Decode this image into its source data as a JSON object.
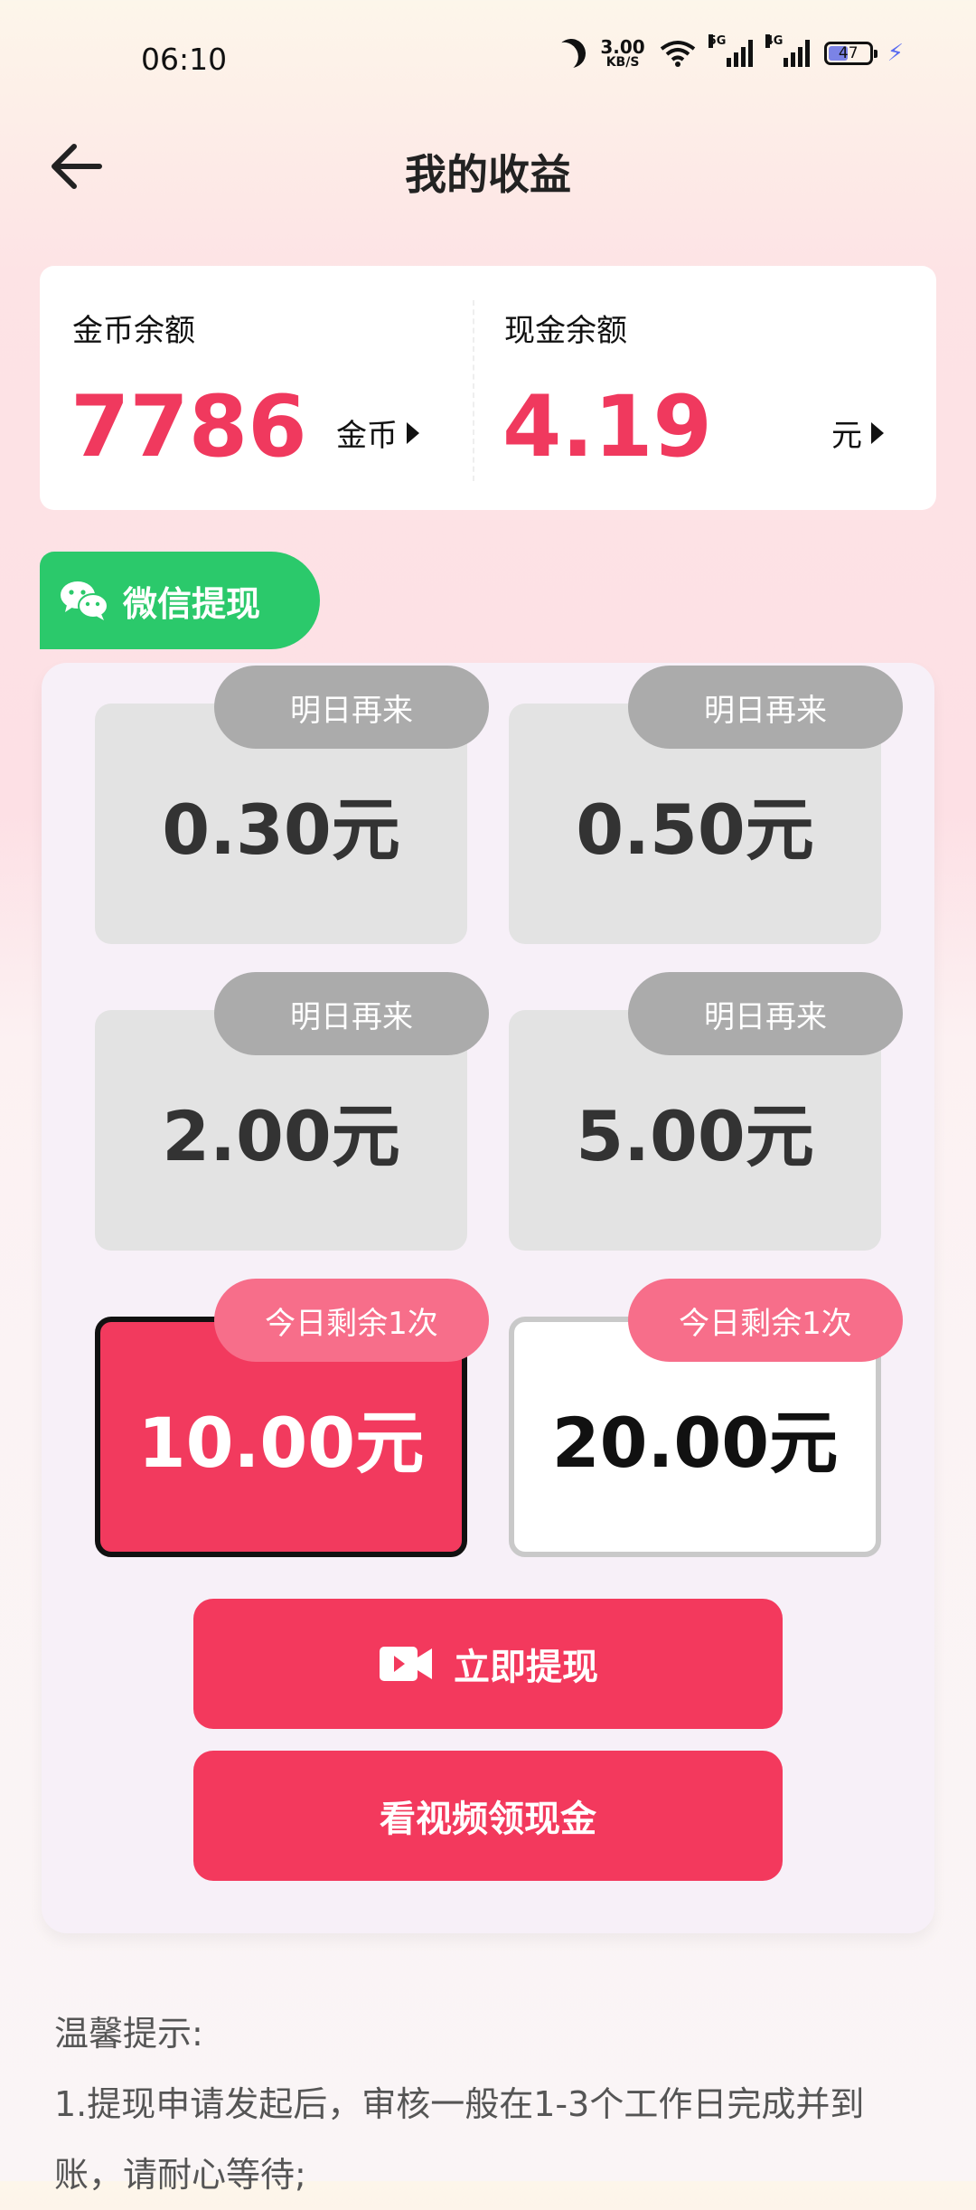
{
  "status": {
    "time": "06:10",
    "speed_value": "3.00",
    "speed_unit": "KB/S",
    "sig1_tag": "5G",
    "sig2_tag": "4G",
    "battery": "47"
  },
  "header": {
    "title": "我的收益"
  },
  "balance": {
    "coin_label": "金币余额",
    "coin_value": "7786",
    "coin_unit": "金币",
    "cash_label": "现金余额",
    "cash_value": "4.19",
    "cash_unit": "元"
  },
  "withdraw": {
    "tab_label": "微信提现",
    "options": [
      {
        "amount": "0.30元",
        "badge": "明日再来"
      },
      {
        "amount": "0.50元",
        "badge": "明日再来"
      },
      {
        "amount": "2.00元",
        "badge": "明日再来"
      },
      {
        "amount": "5.00元",
        "badge": "明日再来"
      },
      {
        "amount": "10.00元",
        "badge": "今日剩余1次"
      },
      {
        "amount": "20.00元",
        "badge": "今日剩余1次"
      }
    ],
    "withdraw_button": "立即提现",
    "video_button": "看视频领现金"
  },
  "tips": {
    "title": "温馨提示:",
    "line1": "1.提现申请发起后，审核一般在1-3个工作日完成并到",
    "line2": "账，请耐心等待;"
  },
  "colors": {
    "accent": "#f3395d",
    "wechat": "#2bc96b",
    "disabled_badge": "#ababab",
    "remaining_badge": "#f76e8a"
  }
}
